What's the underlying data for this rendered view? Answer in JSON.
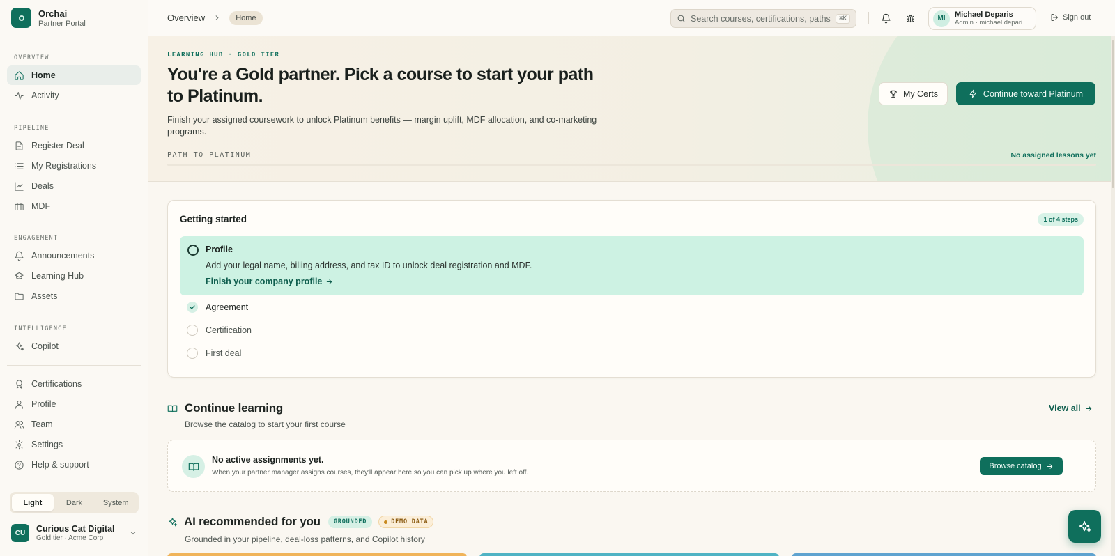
{
  "brand": {
    "name": "Orchai",
    "sub": "Partner Portal"
  },
  "sidebar": {
    "sections": [
      {
        "label": "OVERVIEW",
        "items": [
          {
            "label": "Home",
            "icon": "home-icon",
            "active": true
          },
          {
            "label": "Activity",
            "icon": "activity-icon"
          }
        ]
      },
      {
        "label": "PIPELINE",
        "items": [
          {
            "label": "Register Deal",
            "icon": "file-icon"
          },
          {
            "label": "My Registrations",
            "icon": "list-icon"
          },
          {
            "label": "Deals",
            "icon": "chart-line-icon"
          },
          {
            "label": "MDF",
            "icon": "briefcase-icon"
          }
        ]
      },
      {
        "label": "ENGAGEMENT",
        "items": [
          {
            "label": "Announcements",
            "icon": "bell-icon"
          },
          {
            "label": "Learning Hub",
            "icon": "graduation-cap-icon"
          },
          {
            "label": "Assets",
            "icon": "folder-icon"
          }
        ]
      },
      {
        "label": "INTELLIGENCE",
        "items": [
          {
            "label": "Copilot",
            "icon": "sparkles-icon"
          }
        ]
      }
    ],
    "bottom": [
      {
        "label": "Certifications",
        "icon": "award-icon"
      },
      {
        "label": "Profile",
        "icon": "user-icon"
      },
      {
        "label": "Team",
        "icon": "users-icon"
      },
      {
        "label": "Settings",
        "icon": "gear-icon"
      },
      {
        "label": "Help & support",
        "icon": "help-circle-icon"
      }
    ],
    "theme": {
      "light": "Light",
      "dark": "Dark",
      "system": "System",
      "selected": "Light"
    },
    "org": {
      "initials": "CU",
      "name": "Curious Cat Digital",
      "sub": "Gold tier · Acme Corp"
    }
  },
  "topbar": {
    "breadcrumb_root": "Overview",
    "breadcrumb_current": "Home",
    "search_placeholder": "Search courses, certifications, paths",
    "search_shortcut": "⌘K",
    "user": {
      "initials": "MI",
      "name": "Michael Deparis",
      "role": "Admin · michael.deparis@acme.com"
    },
    "signout": "Sign out"
  },
  "hero": {
    "eyebrow": "LEARNING HUB · GOLD TIER",
    "title": "You're a Gold partner. Pick a course to start your path to Platinum.",
    "description": "Finish your assigned coursework to unlock Platinum benefits — margin uplift, MDF allocation, and co-marketing programs.",
    "path_label": "PATH TO PLATINUM",
    "path_status": "No assigned lessons yet",
    "progress": 0,
    "btn_certs": "My Certs",
    "btn_continue": "Continue toward Platinum"
  },
  "getting_started": {
    "title": "Getting started",
    "badge": "1 of 4 steps",
    "active": {
      "title": "Profile",
      "desc": "Add your legal name, billing address, and tax ID to unlock deal registration and MDF.",
      "link": "Finish your company profile"
    },
    "steps": [
      {
        "label": "Agreement",
        "done": true
      },
      {
        "label": "Certification",
        "done": false
      },
      {
        "label": "First deal",
        "done": false
      }
    ]
  },
  "continue_learning": {
    "title": "Continue learning",
    "sub": "Browse the catalog to start your first course",
    "view_all": "View all",
    "empty_title": "No active assignments yet.",
    "empty_desc": "When your partner manager assigns courses, they'll appear here so you can pick up where you left off.",
    "browse": "Browse catalog"
  },
  "ai_recommended": {
    "title": "AI recommended for you",
    "tag_grounded": "GROUNDED",
    "tag_demo": "DEMO DATA",
    "sub": "Grounded in your pipeline, deal-loss patterns, and Copilot history"
  },
  "colors": {
    "accent": "#0f6f5c",
    "accent_soft": "#cdf2e3",
    "background": "#faf7f1"
  }
}
